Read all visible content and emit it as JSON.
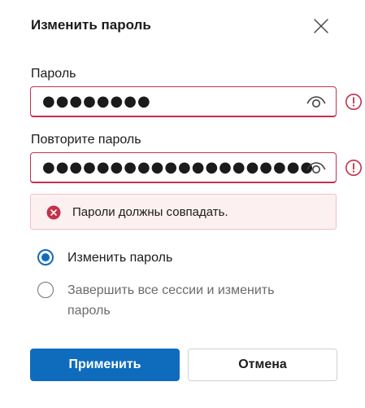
{
  "dialog": {
    "title": "Изменить пароль",
    "close_icon": "close-icon"
  },
  "password": {
    "label": "Пароль",
    "value": "●●●●●●●●",
    "show_icon": "eye-icon",
    "status_icon": "alert-circle-icon"
  },
  "confirm": {
    "label": "Повторите пароль",
    "value": "●●●●●●●●●●●●●●●●●●●●",
    "show_icon": "eye-icon",
    "status_icon": "alert-circle-icon"
  },
  "error": {
    "icon": "error-circle-icon",
    "message": "Пароли должны совпадать."
  },
  "options": [
    {
      "label": "Изменить пароль",
      "selected": true
    },
    {
      "label": "Завершить все сессии и изменить пароль",
      "selected": false
    }
  ],
  "buttons": {
    "apply": "Применить",
    "cancel": "Отмена"
  },
  "colors": {
    "accent": "#0f6cbd",
    "error": "#c4314b",
    "error_bg": "#fdf0f1"
  }
}
